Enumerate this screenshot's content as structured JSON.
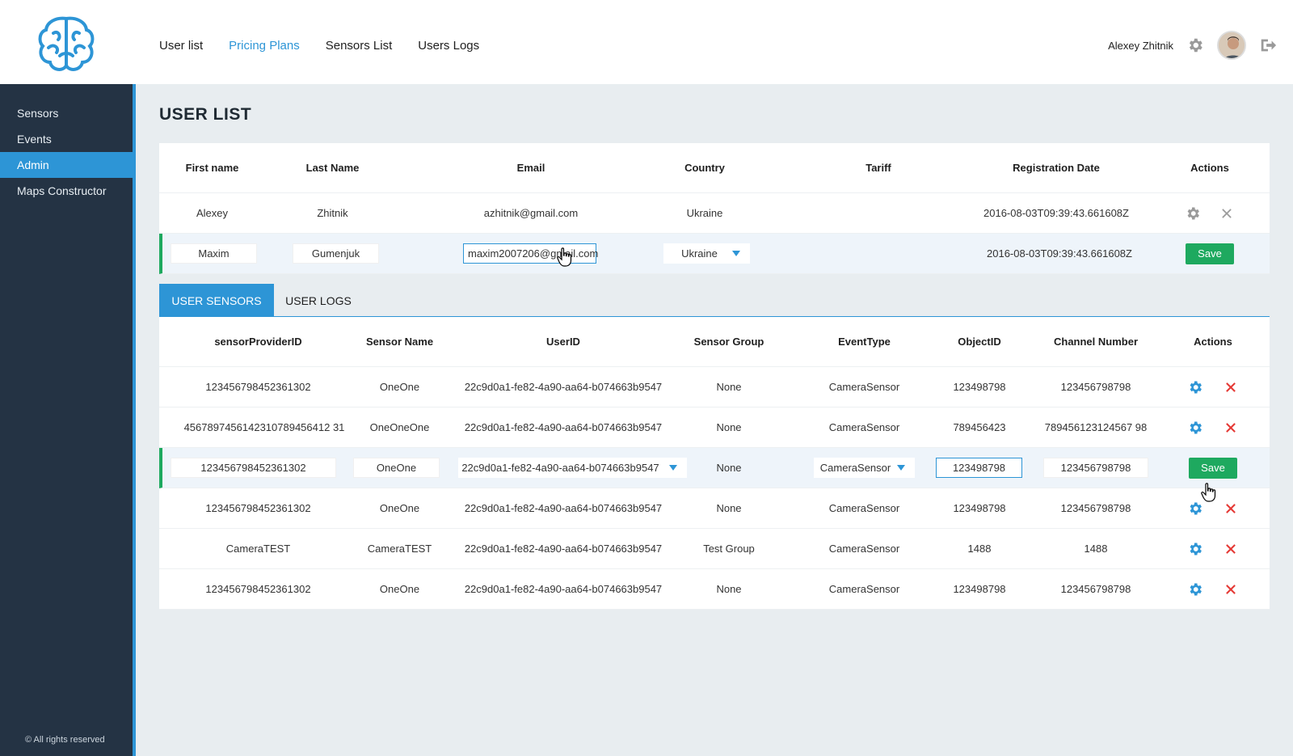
{
  "header": {
    "nav": [
      "User list",
      "Pricing Plans",
      "Sensors List",
      "Users Logs"
    ],
    "active_nav": "Pricing Plans",
    "user_name": "Alexey Zhitnik"
  },
  "sidebar": {
    "items": [
      "Sensors",
      "Events",
      "Admin",
      "Maps Constructor"
    ],
    "active": "Admin",
    "copyright": "© All rights reserved"
  },
  "page": {
    "title": "USER LIST"
  },
  "user_table": {
    "headers": [
      "First name",
      "Last Name",
      "Email",
      "Country",
      "Tariff",
      "Registration Date",
      "Actions"
    ],
    "rows": [
      {
        "first": "Alexey",
        "last": "Zhitnik",
        "email": "azhitnik@gmail.com",
        "country": "Ukraine",
        "tariff": "",
        "date": "2016-08-03T09:39:43.661608Z"
      }
    ],
    "edit_row": {
      "first": "Maxim",
      "last": "Gumenjuk",
      "email": "maxim2007206@gmail.com",
      "country": "Ukraine",
      "tariff": "",
      "date": "2016-08-03T09:39:43.661608Z",
      "save": "Save"
    }
  },
  "tabs": [
    "USER SENSORS",
    "USER LOGS"
  ],
  "active_tab": "USER SENSORS",
  "sensor_table": {
    "headers": [
      "sensorProviderID",
      "Sensor Name",
      "UserID",
      "Sensor Group",
      "EventType",
      "ObjectID",
      "Channel Number",
      "Actions"
    ],
    "rows": [
      {
        "provider": "123456798452361302",
        "name": "OneOne",
        "user": "22c9d0a1-fe82-4a90-aa64-b074663b9547",
        "group": "None",
        "event": "CameraSensor",
        "object": "123498798",
        "channel": "123456798798"
      },
      {
        "provider": "4567897456142310789456412 31",
        "name": "OneOneOne",
        "user": "22c9d0a1-fe82-4a90-aa64-b074663b9547",
        "group": "None",
        "event": "CameraSensor",
        "object": "789456423",
        "channel": "789456123124567 98"
      }
    ],
    "edit_row": {
      "provider": "123456798452361302",
      "name": "OneOne",
      "user": "22c9d0a1-fe82-4a90-aa64-b074663b9547",
      "group": "None",
      "event": "CameraSensor",
      "object": "123498798",
      "channel": "123456798798",
      "save": "Save"
    },
    "rows_after": [
      {
        "provider": "123456798452361302",
        "name": "OneOne",
        "user": "22c9d0a1-fe82-4a90-aa64-b074663b9547",
        "group": "None",
        "event": "CameraSensor",
        "object": "123498798",
        "channel": "123456798798"
      },
      {
        "provider": "CameraTEST",
        "name": "CameraTEST",
        "user": "22c9d0a1-fe82-4a90-aa64-b074663b9547",
        "group": "Test Group",
        "event": "CameraSensor",
        "object": "1488",
        "channel": "1488"
      },
      {
        "provider": "123456798452361302",
        "name": "OneOne",
        "user": "22c9d0a1-fe82-4a90-aa64-b074663b9547",
        "group": "None",
        "event": "CameraSensor",
        "object": "123498798",
        "channel": "123456798798"
      }
    ]
  },
  "colors": {
    "accent": "#2d95d6",
    "sidebar": "#243344",
    "save": "#1ea95f",
    "delete": "#e53935"
  },
  "icons": [
    "brain-logo-icon",
    "gear-icon",
    "avatar",
    "logout-icon",
    "close-icon",
    "delete-icon",
    "chevron-down-icon",
    "hand-cursor-icon"
  ]
}
